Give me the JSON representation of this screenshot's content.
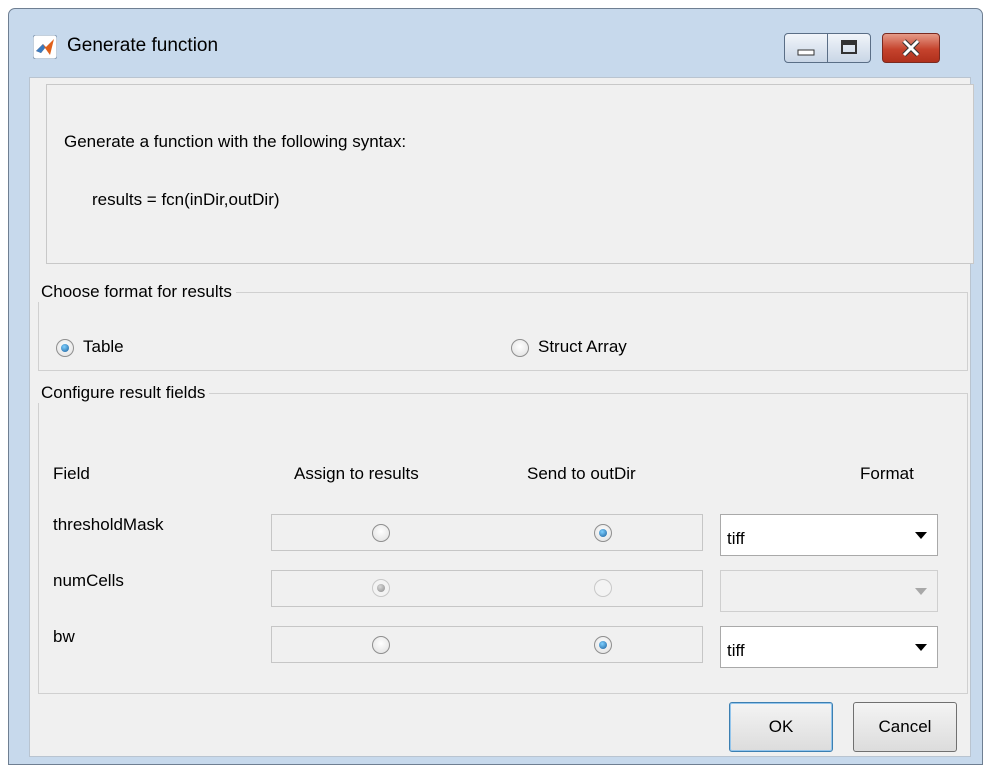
{
  "window": {
    "title": "Generate function",
    "controls": [
      "minimize-icon",
      "maximize-icon",
      "close-icon"
    ],
    "title_bar_color": "#c7d9ec"
  },
  "description": {
    "line1": "Generate a function with the following syntax:",
    "syntax": "results = fcn(inDir,outDir)"
  },
  "format_group": {
    "legend": "Choose format for results",
    "options": [
      {
        "label": "Table",
        "selected": true
      },
      {
        "label": "Struct Array",
        "selected": false
      }
    ]
  },
  "fields_group": {
    "legend": "Configure result fields",
    "headers": {
      "field": "Field",
      "assign": "Assign to results",
      "send": "Send to outDir",
      "format": "Format"
    },
    "rows": [
      {
        "field": "thresholdMask",
        "assign_selected": false,
        "send_selected": true,
        "send_enabled": true,
        "format": "tiff",
        "format_enabled": true
      },
      {
        "field": "numCells",
        "assign_selected": true,
        "assign_enabled": false,
        "send_selected": false,
        "send_enabled": false,
        "format": "",
        "format_enabled": false
      },
      {
        "field": "bw",
        "assign_selected": false,
        "send_selected": true,
        "send_enabled": true,
        "format": "tiff",
        "format_enabled": true
      }
    ]
  },
  "buttons": {
    "ok": "OK",
    "cancel": "Cancel"
  },
  "colors": {
    "accent": "#1a5e9c",
    "close_button": "#c5432d"
  }
}
